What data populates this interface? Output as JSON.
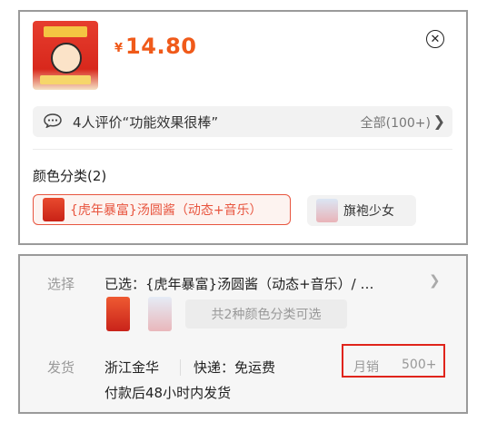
{
  "product": {
    "price_symbol": "¥",
    "price_value": "14.80"
  },
  "review": {
    "summary": "4人评价“功能效果很棒”",
    "all_label": "全部(100+)"
  },
  "color_section": {
    "title": "颜色分类(2)",
    "options": [
      {
        "label": "{虎年暴富}汤圆酱（动态+音乐）",
        "selected": true
      },
      {
        "label": "旗袍少女",
        "selected": false
      }
    ]
  },
  "details": {
    "select_label": "选择",
    "selected_text": "已选：{虎年暴富}汤圆酱（动态+音乐）/ …",
    "color_count_text": "共2种颜色分类可选",
    "ship_label": "发货",
    "ship_origin": "浙江金华",
    "ship_method": "快递：免运费",
    "ship_time": "付款后48小时内发货",
    "monthly_sales_label": "月销",
    "monthly_sales_value": "500+"
  },
  "colors": {
    "accent": "#f05a1a",
    "selected_border": "#e8553f",
    "highlight_box": "#e0241b"
  }
}
